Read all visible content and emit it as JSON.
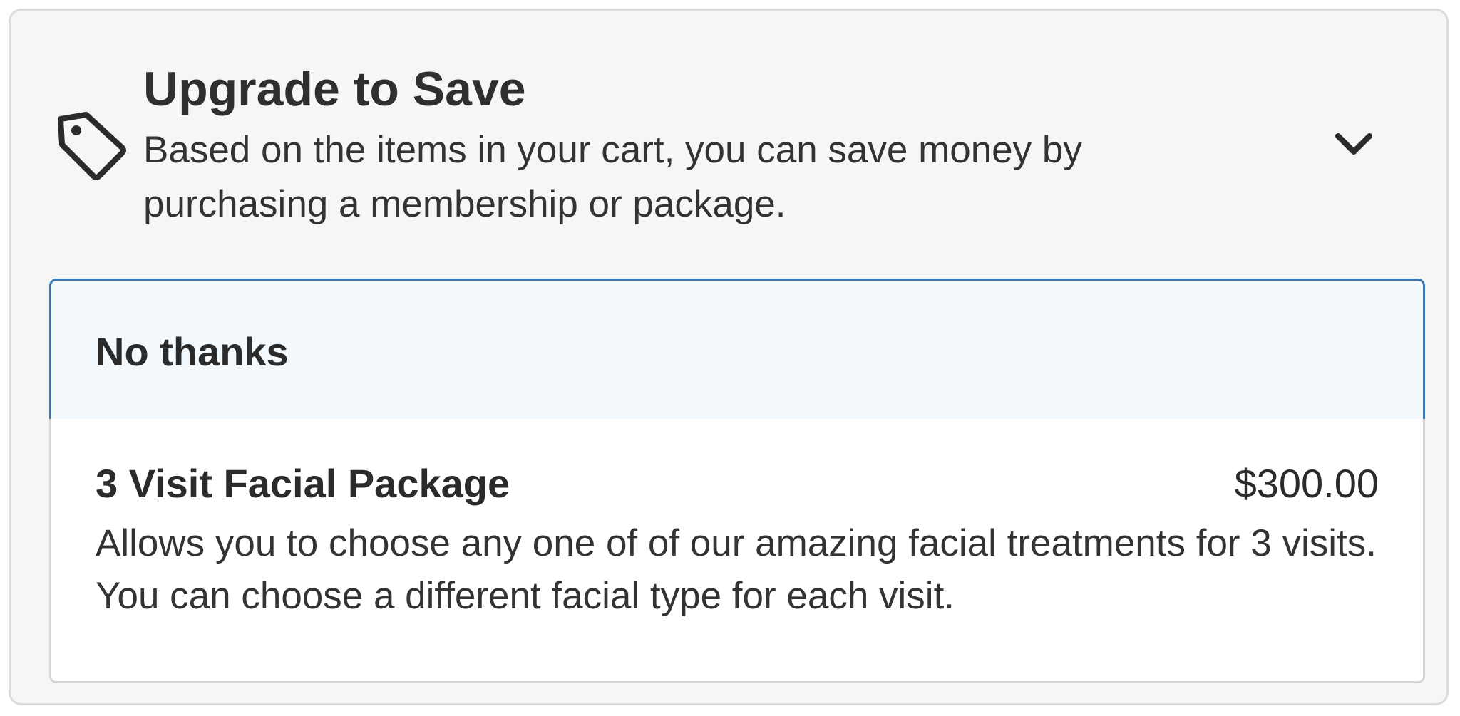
{
  "upgrade_panel": {
    "title": "Upgrade to Save",
    "description": "Based on the items in your cart, you can save money by purchasing a membership or package.",
    "icon": "tag-icon",
    "toggle_icon": "chevron-down-icon"
  },
  "options": [
    {
      "label": "No thanks",
      "selected": true
    },
    {
      "name": "3 Visit Facial Package",
      "price": "$300.00",
      "description": "Allows you to choose any one of of our amazing facial treatments for 3 visits. You can choose a different facial type for each visit.",
      "selected": false
    }
  ],
  "colors": {
    "panel_background": "#f6f6f6",
    "selected_border": "#3a76b0",
    "selected_background": "#f3f9fd",
    "text": "#2b2b2b"
  }
}
